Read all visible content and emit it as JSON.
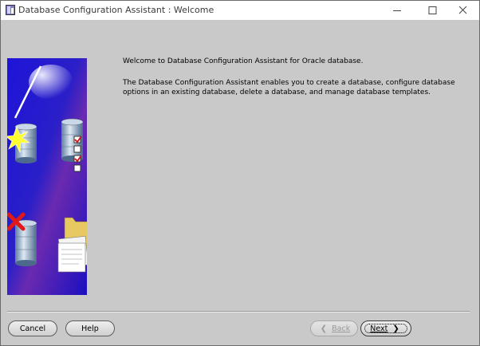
{
  "window": {
    "title": "Database Configuration Assistant : Welcome",
    "controls": {
      "minimize_icon": "minimize-icon",
      "maximize_icon": "maximize-icon",
      "close_icon": "close-icon"
    }
  },
  "content": {
    "welcome": "Welcome to Database Configuration Assistant for Oracle database.",
    "description_line1": "The Database Configuration Assistant enables you to create a database, configure database",
    "description_line2": "options in an existing database, delete a database, and manage database templates."
  },
  "buttons": {
    "cancel": "Cancel",
    "help": "Help",
    "back": "Back",
    "next": "Next"
  },
  "colors": {
    "window_bg": "#c9c9c9",
    "art_blue": "#2a1fc8",
    "art_purple": "#5a2aa8"
  }
}
